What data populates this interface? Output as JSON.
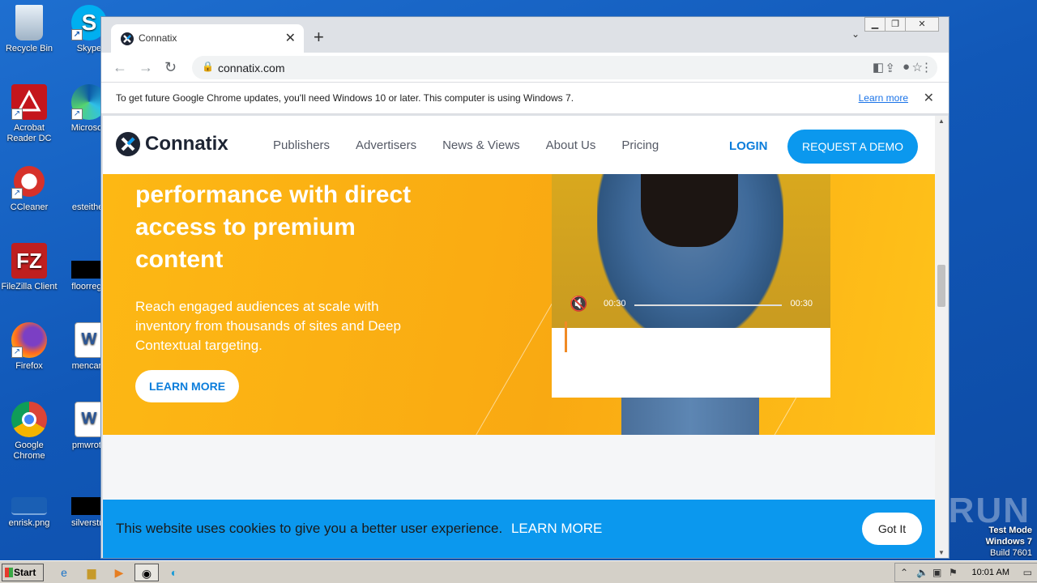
{
  "desktop": {
    "icons_col1": [
      {
        "label": "Recycle Bin",
        "icon": "recycle-bin-icon"
      },
      {
        "label": "Acrobat Reader DC",
        "icon": "acrobat-icon"
      },
      {
        "label": "CCleaner",
        "icon": "ccleaner-icon"
      },
      {
        "label": "FileZilla Client",
        "icon": "filezilla-icon"
      },
      {
        "label": "Firefox",
        "icon": "firefox-icon"
      },
      {
        "label": "Google Chrome",
        "icon": "chrome-icon"
      },
      {
        "label": "enrisk.png",
        "icon": "image-file-icon"
      }
    ],
    "icons_col2": [
      {
        "label": "Skype",
        "icon": "skype-icon"
      },
      {
        "label": "Microsoft",
        "icon": "edge-icon"
      },
      {
        "label": "esteither",
        "icon": "file-icon"
      },
      {
        "label": "floorrega",
        "icon": "black-file-icon"
      },
      {
        "label": "mencare",
        "icon": "word-doc-icon"
      },
      {
        "label": "pmwrote",
        "icon": "word-doc-icon"
      },
      {
        "label": "silverstru",
        "icon": "black-file-icon"
      }
    ],
    "watermark": "ANY RUN",
    "test_mode": [
      "Test Mode",
      "Windows 7",
      "Build 7601"
    ]
  },
  "browser": {
    "tab_title": "Connatix",
    "url": "connatix.com",
    "infobar_message": "To get future Google Chrome updates, you'll need Windows 10 or later. This computer is using Windows 7.",
    "infobar_link": "Learn more"
  },
  "site": {
    "brand": "Connatix",
    "nav": [
      "Publishers",
      "Advertisers",
      "News & Views",
      "About Us",
      "Pricing"
    ],
    "login": "LOGIN",
    "demo": "REQUEST A DEMO",
    "headline": "performance with direct access to premium content",
    "sub": "Reach engaged audiences at scale with inventory from thousands of sites and Deep Contextual targeting.",
    "learn_more": "LEARN MORE",
    "video_time_left": "00:30",
    "video_time_right": "00:30",
    "cookie_text": "This website uses cookies to give you a better user experience.",
    "cookie_link": "LEARN MORE",
    "cookie_button": "Got It"
  },
  "taskbar": {
    "start": "Start",
    "clock": "10:01 AM"
  },
  "colors": {
    "accent_blue": "#0b98ee",
    "hero_yellow": "#fdb814",
    "brand_dark": "#1d2433"
  }
}
